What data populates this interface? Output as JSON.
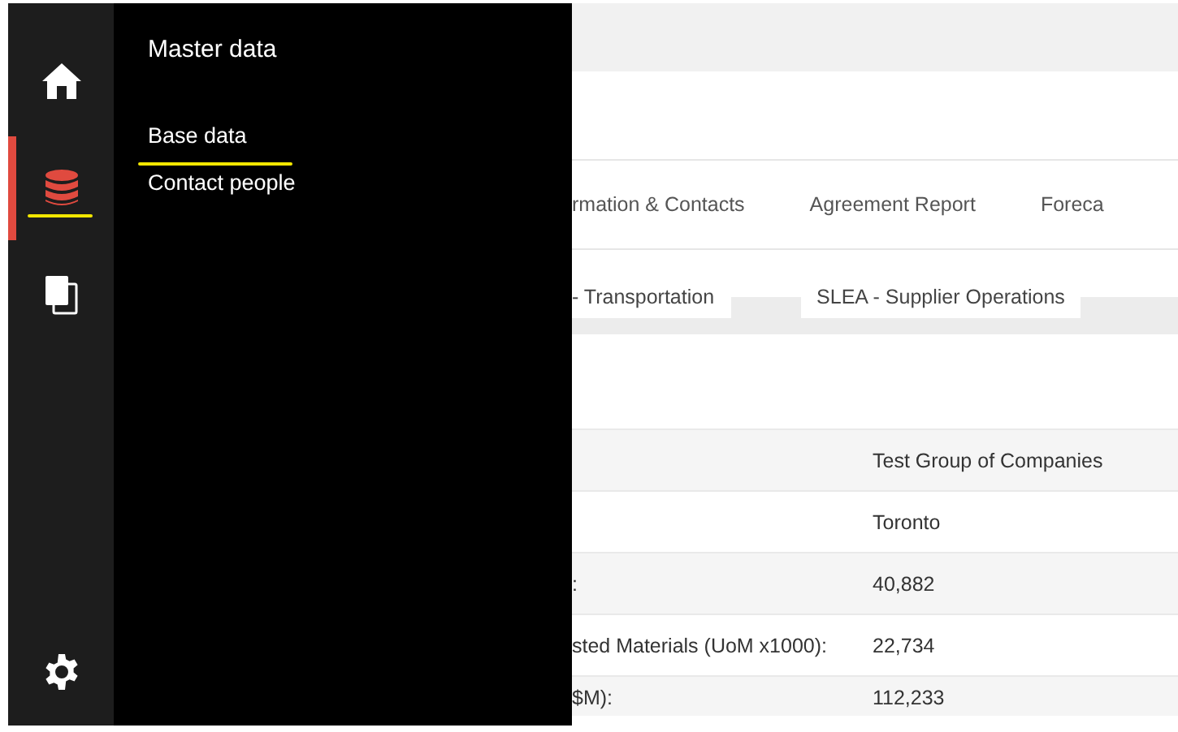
{
  "rail": {
    "items": [
      {
        "selected": false,
        "highlighted": false
      },
      {
        "selected": true,
        "highlighted": true
      },
      {
        "selected": false,
        "highlighted": false
      }
    ]
  },
  "flyout": {
    "title": "Master data",
    "items": [
      {
        "label": "Base data",
        "highlighted": true
      },
      {
        "label": "Contact people",
        "highlighted": false
      }
    ]
  },
  "tabs": [
    {
      "label": "rmation & Contacts"
    },
    {
      "label": "Agreement Report"
    },
    {
      "label": "Foreca"
    }
  ],
  "subtabs": [
    {
      "label": "- Transportation"
    },
    {
      "label": "SLEA -  Supplier Operations"
    }
  ],
  "table": {
    "rows": [
      {
        "value": "Test Group of Companies"
      },
      {
        "value": "Toronto"
      },
      {
        "label": ":",
        "value": "40,882"
      },
      {
        "label": "sted Materials (UoM x1000):",
        "value": "22,734"
      },
      {
        "label": "$M):",
        "value": "112,233"
      }
    ]
  }
}
